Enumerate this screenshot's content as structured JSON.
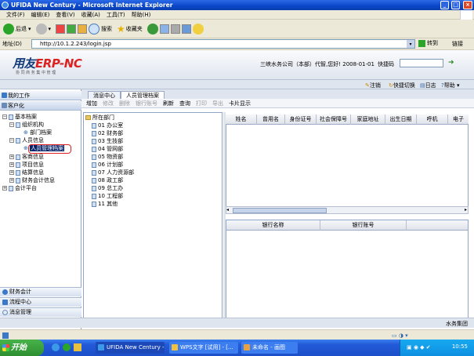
{
  "window": {
    "title": "UFIDA New Century - Microsoft Internet Explorer"
  },
  "menu": {
    "items": [
      "文件(F)",
      "编辑(E)",
      "查看(V)",
      "收藏(A)",
      "工具(T)",
      "帮助(H)"
    ]
  },
  "ietoolbar": {
    "back": "后退",
    "search": "搜索",
    "favorites": "收藏夹"
  },
  "address": {
    "label": "地址(D)",
    "url": "http://10.1.2.243/login.jsp",
    "go": "转到",
    "links": "链接"
  },
  "header": {
    "logo": {
      "main": "用友",
      "erp": "ERP-",
      "nc": "NC",
      "sub": "协 同 商 务    集 中 管 理"
    },
    "company": "三峡水务公司（本部）代智,您好! 2008-01-01",
    "shortcut_label": "快捷码"
  },
  "subbar": {
    "logout": "注销",
    "quick_switch": "快捷切换",
    "log": "日志",
    "help": "帮助"
  },
  "left": {
    "my_work": "我的工作",
    "customize": "客户化",
    "tree": {
      "basic": "基本档案",
      "org": "组织机构",
      "dept_archive": "部门档案",
      "personnel": "人员信息",
      "person_archive": "人员管理档案",
      "customer": "客商信息",
      "project": "项目信息",
      "settlement": "结算信息",
      "finance": "财务会计信息",
      "platform": "会计平台"
    },
    "bottom": {
      "finance": "财务会计",
      "process": "流程中心",
      "message": "消息管理"
    }
  },
  "tabs": {
    "message": "消息中心",
    "person_archive": "人员管理档案"
  },
  "toolbar": {
    "add": "增加",
    "edit": "修改",
    "delete": "删除",
    "bank": "银行账号",
    "refresh": "刷新",
    "query": "查询",
    "print": "打印",
    "export": "导出",
    "card": "卡片显示"
  },
  "dept_tree": {
    "root": "所在部门",
    "items": [
      "01 办公室",
      "02 财务部",
      "03 生技部",
      "04 管网部",
      "05 物资部",
      "06 计划部",
      "07 人力资源部",
      "08 政工部",
      "09 总工办",
      "10 工程部",
      "11 其他"
    ]
  },
  "grid": {
    "headers": [
      "姓名",
      "曾用名",
      "身份证号",
      "社会保障号",
      "家庭地址",
      "出生日期",
      "呼机",
      "电子"
    ]
  },
  "bank": {
    "headers": [
      "银行名称",
      "银行账号"
    ]
  },
  "status": {
    "company": "水务集团"
  },
  "taskbar": {
    "start": "开始",
    "tasks": [
      "UFIDA New Century -...",
      "WPS文字 [试用] - [...",
      "未命名 - 画图"
    ],
    "clock": "10:55"
  }
}
